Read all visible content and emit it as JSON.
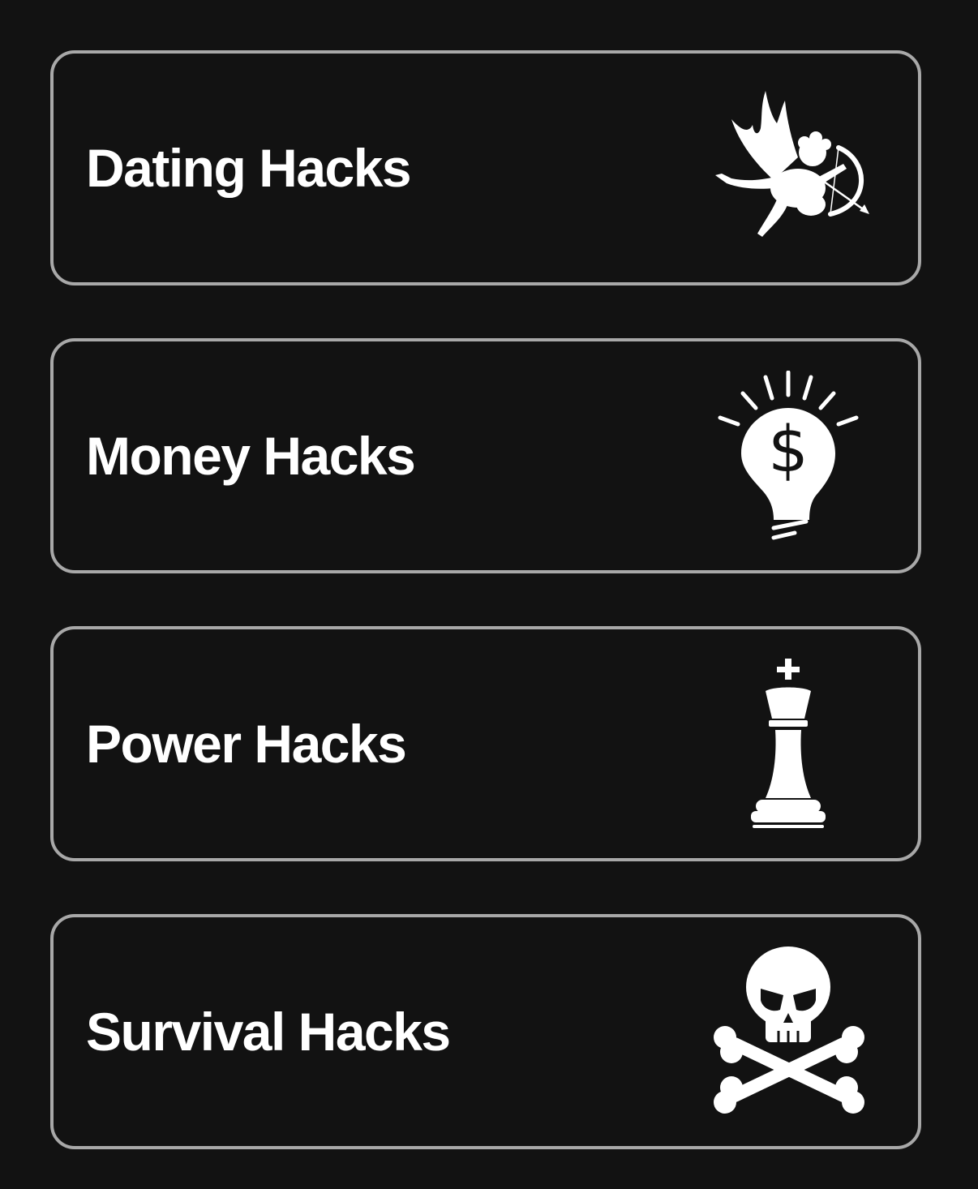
{
  "colors": {
    "background": "#121212",
    "card_border": "#a8a8a8",
    "text": "#ffffff"
  },
  "categories": [
    {
      "label": "Dating Hacks",
      "icon": "cupid-icon"
    },
    {
      "label": "Money Hacks",
      "icon": "money-lightbulb-icon"
    },
    {
      "label": "Power Hacks",
      "icon": "chess-king-icon"
    },
    {
      "label": "Survival Hacks",
      "icon": "skull-crossbones-icon"
    }
  ]
}
